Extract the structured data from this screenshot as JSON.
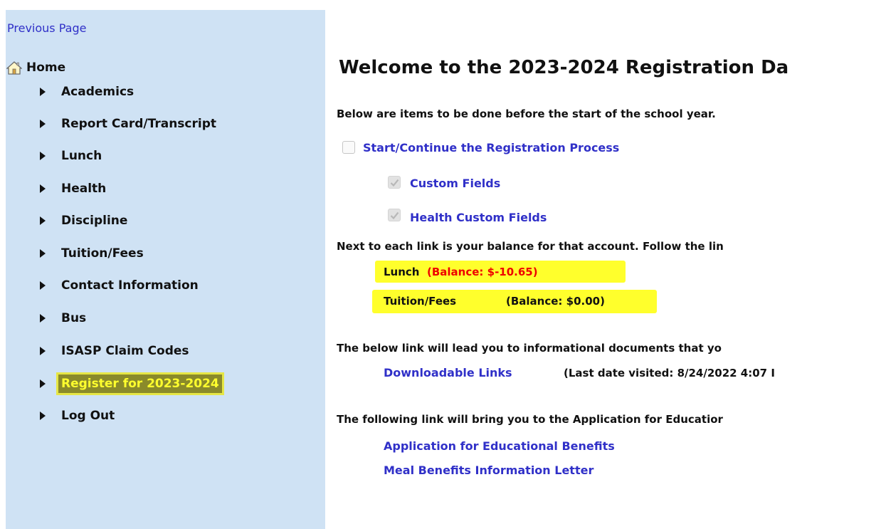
{
  "sidebar": {
    "previous_page": "Previous Page",
    "home": "Home",
    "items": [
      {
        "label": "Academics"
      },
      {
        "label": "Report Card/Transcript"
      },
      {
        "label": "Lunch"
      },
      {
        "label": "Health"
      },
      {
        "label": "Discipline"
      },
      {
        "label": "Tuition/Fees"
      },
      {
        "label": "Contact Information"
      },
      {
        "label": "Bus"
      },
      {
        "label": "ISASP Claim Codes"
      },
      {
        "label": "Register for 2023-2024"
      },
      {
        "label": "Log Out"
      }
    ],
    "highlighted_item": "Register for 2023-2024"
  },
  "main": {
    "title": "Welcome to the 2023-2024 Registration Da",
    "intro": "Below are items to be done before the start of the school year.",
    "tasks": {
      "start": {
        "label": "Start/Continue the Registration Process",
        "checked": false
      },
      "custom_fields": {
        "label": "Custom Fields",
        "checked": true
      },
      "health_custom_fields": {
        "label": "Health Custom Fields",
        "checked": true
      }
    },
    "balance_intro": "Next to each link is your balance for that account. Follow the lin",
    "balances": {
      "lunch_label": "Lunch",
      "lunch_balance": "(Balance: $-10.65)",
      "tuition_label": "Tuition/Fees",
      "tuition_balance": "(Balance: $0.00)"
    },
    "docs_intro": "The below link will lead you to informational documents that yo",
    "downloadable_links": "Downloadable Links",
    "last_visited": "(Last date visited: 8/24/2022 4:07 I",
    "application_intro": "The following link will bring you to the Application for Educatior",
    "application_link": "Application for Educational Benefits",
    "meal_letter_link": "Meal Benefits Information Letter"
  },
  "colors": {
    "sidebar_bg": "#cfe2f4",
    "link": "#3030c8",
    "highlight": "#ffff2c",
    "negative_balance": "#ee0000"
  },
  "icons": [
    "home-icon",
    "triangle-right-icon",
    "checkbox-icon",
    "checkmark-icon"
  ]
}
